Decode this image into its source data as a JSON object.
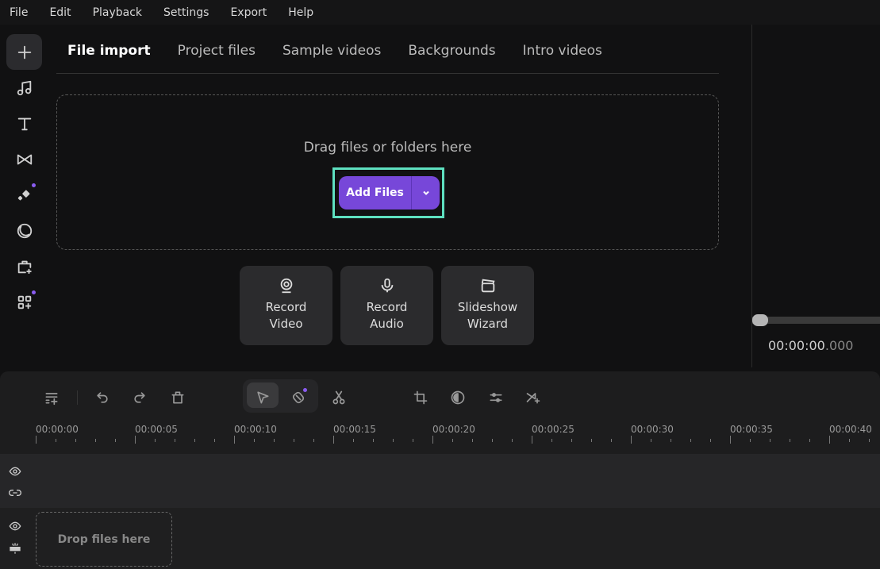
{
  "menu": [
    "File",
    "Edit",
    "Playback",
    "Settings",
    "Export",
    "Help"
  ],
  "sidebar": [
    {
      "icon": "plus-icon",
      "active": true
    },
    {
      "icon": "music-icon"
    },
    {
      "icon": "text-icon"
    },
    {
      "icon": "transition-icon"
    },
    {
      "icon": "effects-sparkle-icon",
      "badge": true
    },
    {
      "icon": "sticker-icon"
    },
    {
      "icon": "store-bag-icon"
    },
    {
      "icon": "apps-icon",
      "badge": true
    }
  ],
  "tabs": [
    "File import",
    "Project files",
    "Sample videos",
    "Backgrounds",
    "Intro videos"
  ],
  "import": {
    "hint": "Drag files or folders here",
    "add_files": "Add Files"
  },
  "actions": [
    {
      "line1": "Record",
      "line2": "Video",
      "icon": "webcam-icon"
    },
    {
      "line1": "Record",
      "line2": "Audio",
      "icon": "microphone-icon"
    },
    {
      "line1": "Slideshow",
      "line2": "Wizard",
      "icon": "clapperboard-icon"
    }
  ],
  "preview": {
    "time_main": "00:00:00",
    "time_ms": ".000",
    "progress": 0
  },
  "timeline": {
    "ruler": [
      "00:00:00",
      "00:00:05",
      "00:00:10",
      "00:00:15",
      "00:00:20",
      "00:00:25",
      "00:00:30",
      "00:00:35",
      "00:00:40"
    ],
    "drop_label": "Drop files here"
  },
  "colors": {
    "accent": "#7747d9",
    "highlight": "#5ee0c0"
  }
}
